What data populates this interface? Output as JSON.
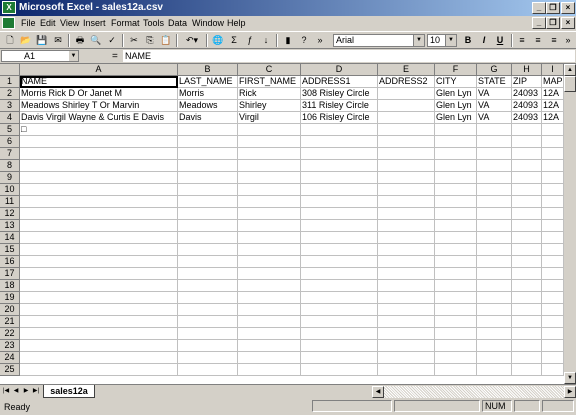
{
  "window": {
    "title": "Microsoft Excel - sales12a.csv"
  },
  "menu": [
    "File",
    "Edit",
    "View",
    "Insert",
    "Format",
    "Tools",
    "Data",
    "Window",
    "Help"
  ],
  "toolbar": {
    "font_name": "Arial",
    "font_size": "10",
    "bold": "B",
    "italic": "I",
    "underline": "U"
  },
  "formula_bar": {
    "cell_ref": "A1",
    "equals": "=",
    "content": "NAME"
  },
  "columns": [
    "A",
    "B",
    "C",
    "D",
    "E",
    "F",
    "G",
    "H",
    "I"
  ],
  "row_numbers": [
    "1",
    "2",
    "3",
    "4",
    "5",
    "6",
    "7",
    "8",
    "9",
    "10",
    "11",
    "12",
    "13",
    "14",
    "15",
    "16",
    "17",
    "18",
    "19",
    "20",
    "21",
    "22",
    "23",
    "24",
    "25"
  ],
  "rows": [
    [
      "NAME",
      "LAST_NAME",
      "FIRST_NAME",
      "ADDRESS1",
      "ADDRESS2",
      "CITY",
      "STATE",
      "ZIP",
      "MAP"
    ],
    [
      "Morris Rick D Or Janet M",
      "Morris",
      "Rick",
      "308 Risley Circle",
      "",
      "Glen Lyn",
      "VA",
      "24093",
      "12A"
    ],
    [
      "Meadows Shirley T Or Marvin",
      "Meadows",
      "Shirley",
      "311 Risley Circle",
      "",
      "Glen Lyn",
      "VA",
      "24093",
      "12A"
    ],
    [
      "Davis Virgil Wayne & Curtis E Davis",
      "Davis",
      "Virgil",
      "106 Risley Circle",
      "",
      "Glen Lyn",
      "VA",
      "24093",
      "12A"
    ],
    [
      "□",
      "",
      "",
      "",
      "",
      "",
      "",
      "",
      ""
    ]
  ],
  "sheet_tab": "sales12a",
  "status": {
    "text": "Ready",
    "num": "NUM"
  }
}
